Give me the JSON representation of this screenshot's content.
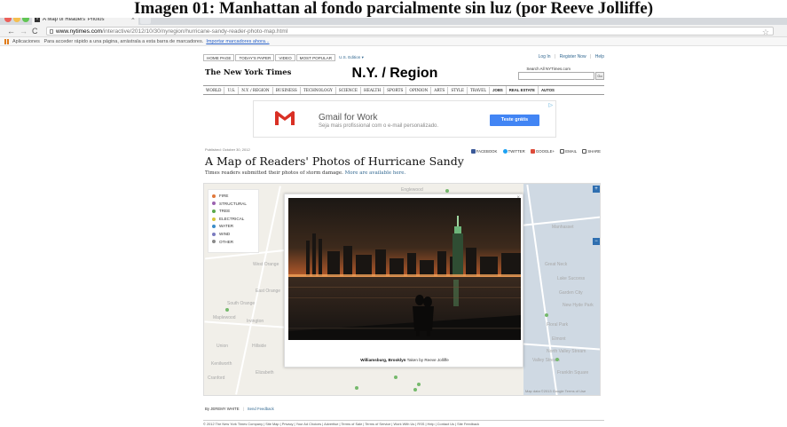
{
  "overlay_caption": "Imagen 01: Manhattan al fondo parcialmente sin luz (por Reeve Jolliffe)",
  "browser": {
    "tab_title": "A Map of Readers' Photos",
    "favicon": "T",
    "url_host": "www.nytimes.com",
    "url_path": "/interactive/2012/10/30/nyregion/hurricane-sandy-reader-photo-map.html",
    "bookmarks_apps": "Aplicaciones",
    "bookmarks_hint": "Para acceder rápido a una página, arrástrala a esta barra de marcadores.",
    "bookmarks_import": "Importar marcadores ahora..."
  },
  "nyt": {
    "top_nav": [
      "HOME PAGE",
      "TODAY'S PAPER",
      "VIDEO",
      "MOST POPULAR"
    ],
    "edition": "U.S. Edition ▾",
    "login": "Log In",
    "register": "Register Now",
    "help": "Help",
    "masthead": "The New York Times",
    "section": "N.Y. / Region",
    "search_label": "Search All NYTimes.com",
    "search_go": "Go",
    "section_nav": [
      "WORLD",
      "U.S.",
      "N.Y. / REGION",
      "BUSINESS",
      "TECHNOLOGY",
      "SCIENCE",
      "HEALTH",
      "SPORTS",
      "OPINION",
      "ARTS",
      "STYLE",
      "TRAVEL",
      "JOBS",
      "REAL ESTATE",
      "AUTOS"
    ],
    "ad": {
      "title": "Gmail for Work",
      "subtitle": "Seja mais profissional com o e-mail personalizado.",
      "button": "Teste grátis"
    },
    "published": "Published: October 30, 2012",
    "headline": "A Map of Readers' Photos of Hurricane Sandy",
    "summary": "Times readers submitted their photos of storm damage.",
    "summary_more": "More are available here.",
    "share": {
      "facebook": "FACEBOOK",
      "twitter": "TWITTER",
      "google": "GOOGLE+",
      "email": "EMAIL",
      "share": "SHARE"
    },
    "legend": [
      {
        "label": "FIRE",
        "color": "#e0783a"
      },
      {
        "label": "STRUCTURAL",
        "color": "#9b62b0"
      },
      {
        "label": "TREE",
        "color": "#5aa84a"
      },
      {
        "label": "ELECTRICAL",
        "color": "#d6c53a"
      },
      {
        "label": "WATER",
        "color": "#3a8cc8"
      },
      {
        "label": "WIND",
        "color": "#7a7abf"
      },
      {
        "label": "OTHER",
        "color": "#8a8a8a"
      }
    ],
    "map_labels": [
      "Englewood",
      "West Orange",
      "East Orange",
      "South Orange",
      "Maplewood",
      "Irvington",
      "Union",
      "Hillside",
      "Elizabeth",
      "Kenilworth",
      "Cranford",
      "Manhasset",
      "Great Neck",
      "New Hyde Park",
      "Floral Park",
      "Elmont",
      "Valley Stream",
      "North Valley Stream",
      "Lake Success",
      "Garden City",
      "Franklin Square"
    ],
    "map_attribution": "Map data ©2013 Google  Terms of Use",
    "photo_caption_place": "Williamsburg, Brooklyn",
    "photo_caption_credit": "Taken by Reeve Jolliffe",
    "byline": "By JEREMY WHITE",
    "send_feedback": "Send Feedback",
    "footer": "© 2012 The New York Times Company  |  Site Map  |  Privacy  |  Your Ad Choices  |  Advertise  |  Terms of Sale  |  Terms of Service  |  Work With Us  |  RSS  |  Help  |  Contact Us  |  Site Feedback"
  },
  "colors": {
    "nyt_link": "#326891",
    "gmail_red": "#d93025",
    "ad_button": "#4285f4",
    "map_land": "#f1efe9",
    "map_water": "#cfd9e3"
  }
}
